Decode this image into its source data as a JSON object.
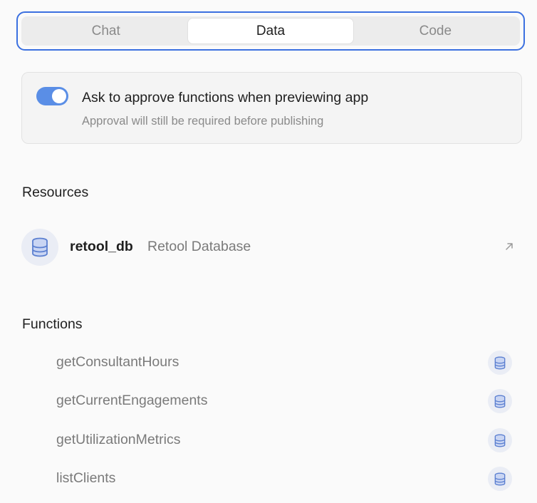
{
  "tabs": [
    {
      "label": "Chat",
      "active": false
    },
    {
      "label": "Data",
      "active": true
    },
    {
      "label": "Code",
      "active": false
    }
  ],
  "approval": {
    "enabled": true,
    "title": "Ask to approve functions when previewing app",
    "subtitle": "Approval will still be required before publishing"
  },
  "resources": {
    "heading": "Resources",
    "items": [
      {
        "name": "retool_db",
        "type": "Retool Database",
        "icon": "database-icon"
      }
    ]
  },
  "functions": {
    "heading": "Functions",
    "items": [
      {
        "name": "getConsultantHours",
        "icon": "database-icon"
      },
      {
        "name": "getCurrentEngagements",
        "icon": "database-icon"
      },
      {
        "name": "getUtilizationMetrics",
        "icon": "database-icon"
      },
      {
        "name": "listClients",
        "icon": "database-icon"
      }
    ]
  },
  "colors": {
    "accent": "#3b70e0",
    "toggle_on": "#5a8ee6",
    "icon_blue": "#5b7fd0"
  }
}
